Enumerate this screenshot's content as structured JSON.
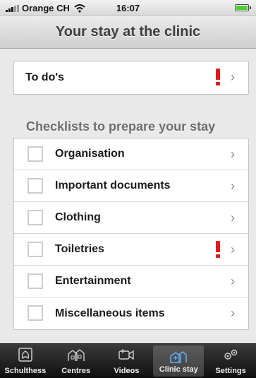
{
  "status_bar": {
    "carrier": "Orange CH",
    "time": "16:07"
  },
  "nav": {
    "title": "Your stay at the clinic"
  },
  "todo": {
    "label": "To do's",
    "has_alert": true
  },
  "section": {
    "heading": "Checklists to prepare your stay"
  },
  "checklists": [
    {
      "label": "Organisation",
      "checked": false,
      "alert": false
    },
    {
      "label": "Important documents",
      "checked": false,
      "alert": false
    },
    {
      "label": "Clothing",
      "checked": false,
      "alert": false
    },
    {
      "label": "Toiletries",
      "checked": false,
      "alert": true
    },
    {
      "label": "Entertainment",
      "checked": false,
      "alert": false
    },
    {
      "label": "Miscellaneous items",
      "checked": false,
      "alert": false
    }
  ],
  "tabs": [
    {
      "label": "Schulthess",
      "icon": "shell-logo-icon",
      "active": false
    },
    {
      "label": "Centres",
      "icon": "buildings-icon",
      "active": false
    },
    {
      "label": "Videos",
      "icon": "video-camera-icon",
      "active": false
    },
    {
      "label": "Clinic stay",
      "icon": "clinic-building-icon",
      "active": true
    },
    {
      "label": "Settings",
      "icon": "gears-icon",
      "active": false
    }
  ],
  "colors": {
    "alert": "#e01b1b",
    "battery": "#4cd22f",
    "tab_bar": "#1f1f1f"
  }
}
